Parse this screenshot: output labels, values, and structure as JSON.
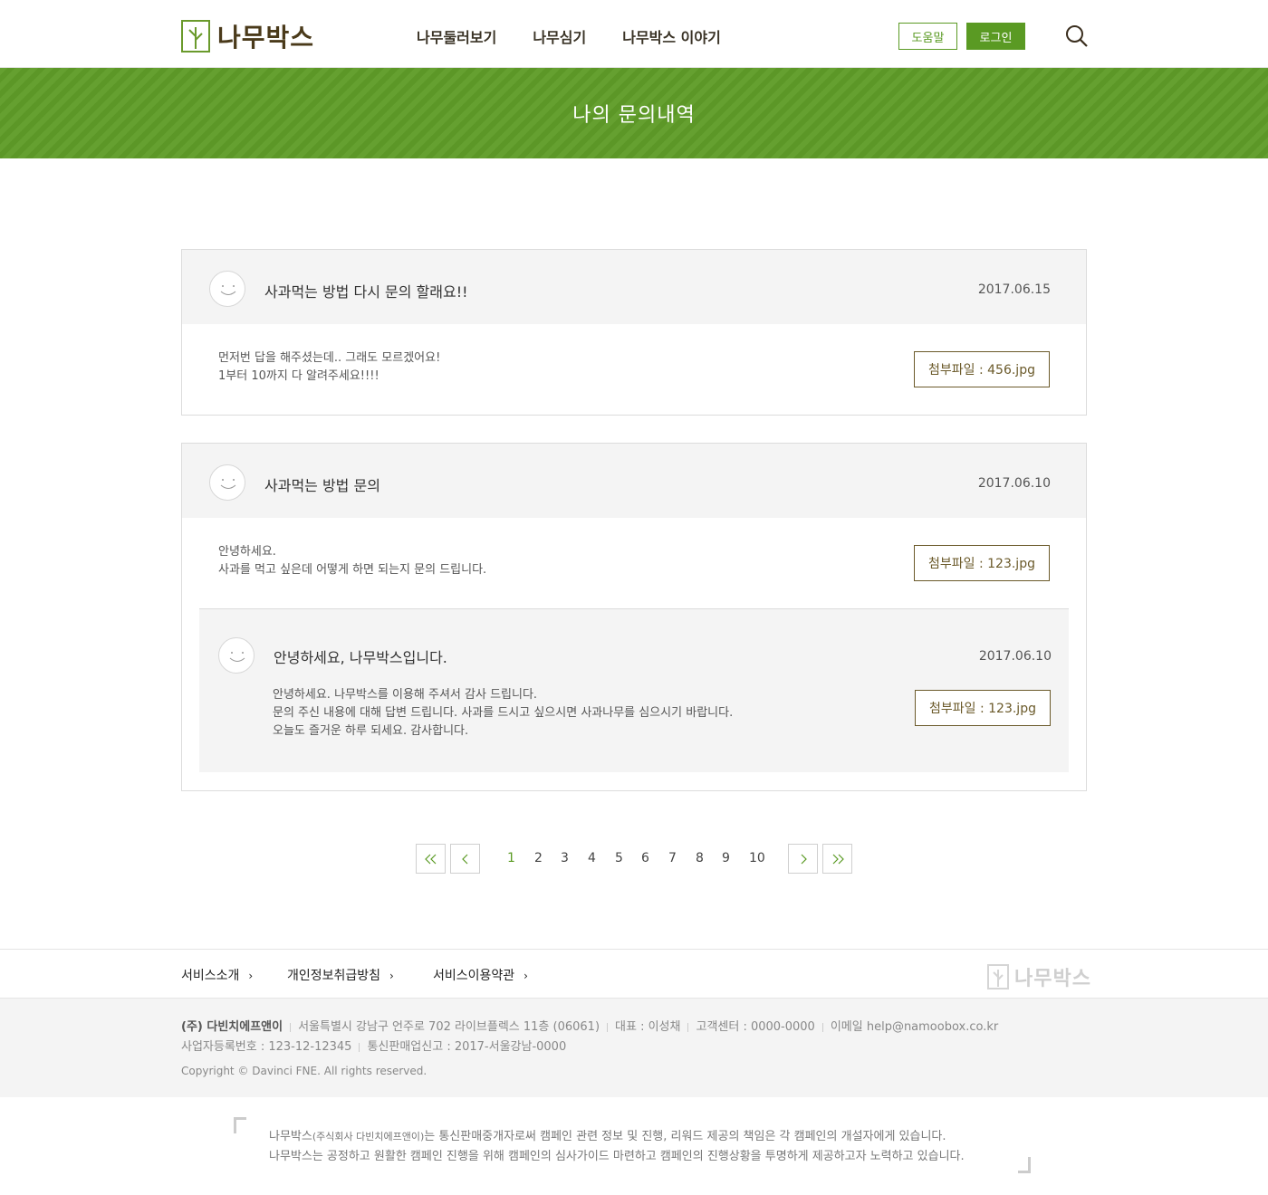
{
  "header": {
    "logo_text": "나무박스",
    "nav": [
      "나무둘러보기",
      "나무심기",
      "나무박스 이야기"
    ],
    "help_label": "도움말",
    "login_label": "로그인"
  },
  "banner": {
    "title": "나의 문의내역"
  },
  "inquiries": [
    {
      "title": "사과먹는 방법 다시 문의 할래요!!",
      "date": "2017.06.15",
      "body": [
        "먼저번 답을 해주셨는데.. 그래도 모르겠어요!",
        "1부터 10까지 다 알려주세요!!!!"
      ],
      "attachment": "첨부파일 : 456.jpg"
    },
    {
      "title": "사과먹는 방법 문의",
      "date": "2017.06.10",
      "body": [
        "안녕하세요.",
        "사과를 먹고 싶은데 어떻게 하면 되는지 문의 드립니다."
      ],
      "attachment": "첨부파일 : 123.jpg",
      "reply": {
        "title": "안녕하세요, 나무박스입니다.",
        "date": "2017.06.10",
        "body": [
          "안녕하세요. 나무박스를 이용해 주셔서 감사 드립니다.",
          "문의 주신 내용에 대해 답변 드립니다. 사과를 드시고 싶으시면 사과나무를 심으시기 바랍니다.",
          "오늘도 즐거운 하루 되세요. 감사합니다."
        ],
        "attachment": "첨부파일 : 123.jpg"
      }
    }
  ],
  "pagination": {
    "first": "«",
    "prev": "‹",
    "next": "›",
    "last": "»",
    "pages": [
      "1",
      "2",
      "3",
      "4",
      "5",
      "6",
      "7",
      "8",
      "9",
      "10"
    ],
    "current": "1"
  },
  "footer": {
    "links": [
      "서비스소개",
      "개인정보취급방침",
      "서비스이용약관"
    ],
    "logo_text": "나무박스",
    "company": "(주) 다빈치에프앤이",
    "address": "서울특별시 강남구 언주로 702 라이브플렉스 11층  (06061)",
    "ceo": "대표 : 이성채",
    "cs": "고객센터 : 0000-0000",
    "email": "이메일 help@namoobox.co.kr",
    "biz_no": "사업자등록번호 : 123-12-12345",
    "ecommerce_no": "통신판매업신고 : 2017-서울강남-0000",
    "copyright": "Copyright © Davinci FNE. All rights reserved.",
    "notice_prefix": "나무박스",
    "notice_small": "(주식회사 다빈치에프앤이)",
    "notice_line1_rest": "는 통신판매중개자로써 캠페인 관련 정보 및 진행, 리워드 제공의 책임은 각 캠페인의 개설자에게 있습니다.",
    "notice_line2": "나무박스는 공정하고 원활한 캠페인 진행을 위해 캠페인의 심사가이드 마련하고 캠페인의 진행상황을 투명하게 제공하고자 노력하고 있습니다."
  },
  "colors": {
    "brand_green": "#5f9c28",
    "brand_brown": "#6b5a2a"
  }
}
